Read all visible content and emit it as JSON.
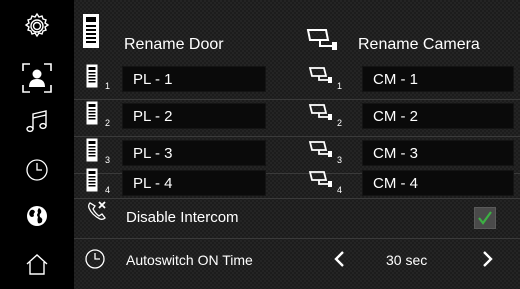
{
  "sidebar": {
    "items": [
      {
        "icon": "gear-icon"
      },
      {
        "icon": "user-frame-icon"
      },
      {
        "icon": "music-note-icon"
      },
      {
        "icon": "clock-icon"
      },
      {
        "icon": "globe-icon"
      },
      {
        "icon": "home-icon"
      }
    ]
  },
  "headers": {
    "door": "Rename Door",
    "camera": "Rename Camera"
  },
  "doors": [
    {
      "num": "1",
      "name": "PL - 1"
    },
    {
      "num": "2",
      "name": "PL - 2"
    },
    {
      "num": "3",
      "name": "PL - 3"
    },
    {
      "num": "4",
      "name": "PL - 4"
    }
  ],
  "cameras": [
    {
      "num": "1",
      "name": "CM - 1"
    },
    {
      "num": "2",
      "name": "CM - 2"
    },
    {
      "num": "3",
      "name": "CM - 3"
    },
    {
      "num": "4",
      "name": "CM - 4"
    }
  ],
  "intercom": {
    "label": "Disable Intercom",
    "checked": true,
    "check_color": "#3cb043"
  },
  "autoswitch": {
    "label": "Autoswitch ON Time",
    "value": "30 sec",
    "prev": "<",
    "next": ">"
  }
}
